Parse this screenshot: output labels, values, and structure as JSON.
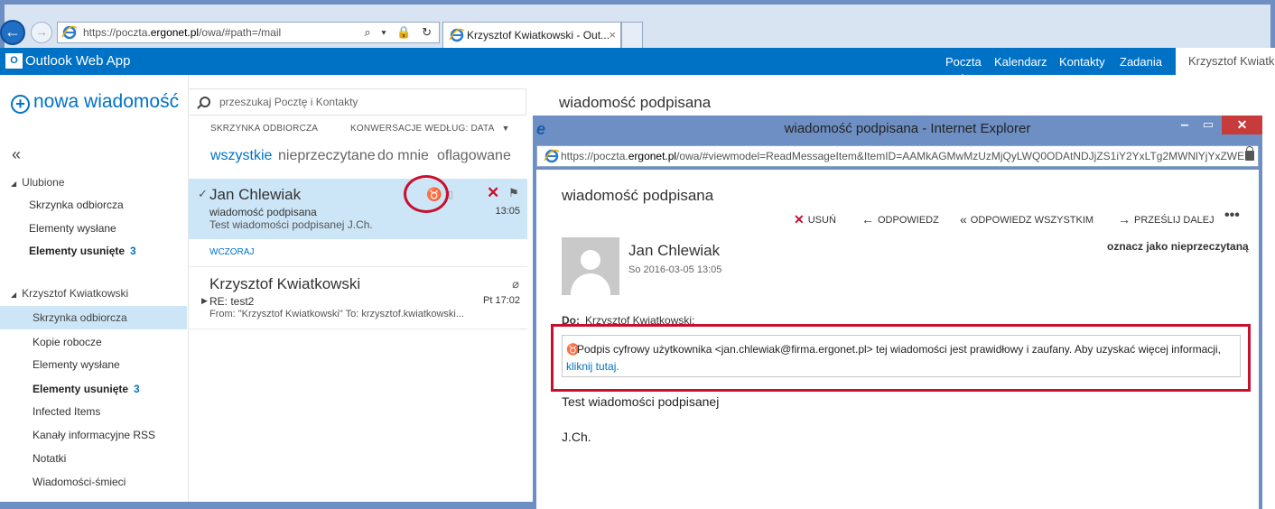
{
  "browser": {
    "url_prefix": "https://poczta.",
    "url_domain": "ergonet.pl",
    "url_path": "/owa/#path=/mail",
    "tab_title": "Krzysztof Kwiatkowski - Out...",
    "tab_close": "×"
  },
  "owa": {
    "logo": "O",
    "app_name": "Outlook Web App",
    "nav": [
      "Poczta",
      "Kalendarz",
      "Kontakty",
      "Zadania"
    ],
    "active_nav": "Poczta",
    "user": "Krzysztof Kwiatkowski"
  },
  "left": {
    "new_message": "nowa wiadomość",
    "collapse": "«",
    "favorites_title": "Ulubione",
    "favorites": [
      {
        "label": "Skrzynka odbiorcza",
        "count": ""
      },
      {
        "label": "Elementy wysłane",
        "count": ""
      },
      {
        "label": "Elementy usunięte",
        "count": "3"
      }
    ],
    "account_title": "Krzysztof Kwiatkowski",
    "folders": [
      {
        "label": "Skrzynka odbiorcza",
        "count": ""
      },
      {
        "label": "Kopie robocze",
        "count": ""
      },
      {
        "label": "Elementy wysłane",
        "count": ""
      },
      {
        "label": "Elementy usunięte",
        "count": "3"
      },
      {
        "label": "Infected Items",
        "count": ""
      },
      {
        "label": "Kanały informacyjne RSS",
        "count": ""
      },
      {
        "label": "Notatki",
        "count": ""
      },
      {
        "label": "Wiadomości-śmieci",
        "count": ""
      }
    ]
  },
  "list": {
    "search_placeholder": "przeszukaj Pocztę i Kontakty",
    "folder_label": "SKRZYNKA ODBIORCZA",
    "sort_label": "KONWERSACJE WEDŁUG: DATA",
    "filters": [
      "wszystkie",
      "nieprzeczytane",
      "do mnie",
      "oflagowane"
    ],
    "active_filter": "wszystkie",
    "messages": [
      {
        "sender": "Jan Chlewiak",
        "subject": "wiadomość podpisana",
        "preview": "Test wiadomości podpisanej J.Ch.",
        "time": "13:05"
      },
      {
        "sender": "Krzysztof Kwiatkowski",
        "subject": "RE: test2",
        "preview": "From: \"Krzysztof Kwiatkowski\" To: krzysztof.kwiatkowski...",
        "time": "Pt 17:02"
      }
    ],
    "date_separator": "WCZORAJ"
  },
  "reading": {
    "title": "wiadomość podpisana"
  },
  "popup": {
    "window_title": "wiadomość podpisana - Internet Explorer",
    "url_prefix": "https://poczta.",
    "url_domain": "ergonet.pl",
    "url_path": "/owa/#viewmodel=ReadMessageItem&ItemID=AAMkAGMwMzUzMjQyLWQ0ODAtNDJjZS1iY2YxLTg2MWNlYjYxZWE",
    "subject": "wiadomość podpisana",
    "actions": {
      "delete": "USUŃ",
      "reply": "ODPOWIEDZ",
      "reply_all": "ODPOWIEDZ WSZYSTKIM",
      "forward": "PRZEŚLIJ DALEJ",
      "more": "•••"
    },
    "sender": "Jan Chlewiak",
    "date": "So 2016-03-05 13:05",
    "mark_unread": "oznacz jako nieprzeczytaną",
    "to_label": "Do:",
    "to_value": "Krzysztof Kwiatkowski;",
    "signature_text": "Podpis cyfrowy użytkownika <jan.chlewiak@firma.ergonet.pl> tej wiadomości jest prawidłowy i zaufany. Aby uzyskać więcej informacji,",
    "signature_link": "kliknij tutaj.",
    "body_line1": "Test wiadomości podpisanej",
    "body_line2": "J.Ch."
  },
  "colors": {
    "owa_blue": "#0072c6",
    "selection": "#cde6f7",
    "highlight_red": "#c8102e",
    "window_frame": "#6d8fc4"
  },
  "icons": [
    "back-arrow-icon",
    "forward-arrow-icon",
    "ie-icon",
    "search-icon",
    "lock-icon",
    "refresh-icon",
    "certificate-icon",
    "delete-icon",
    "flag-icon",
    "paperclip-icon",
    "reply-icon",
    "reply-all-icon",
    "forward-icon",
    "avatar-icon"
  ]
}
